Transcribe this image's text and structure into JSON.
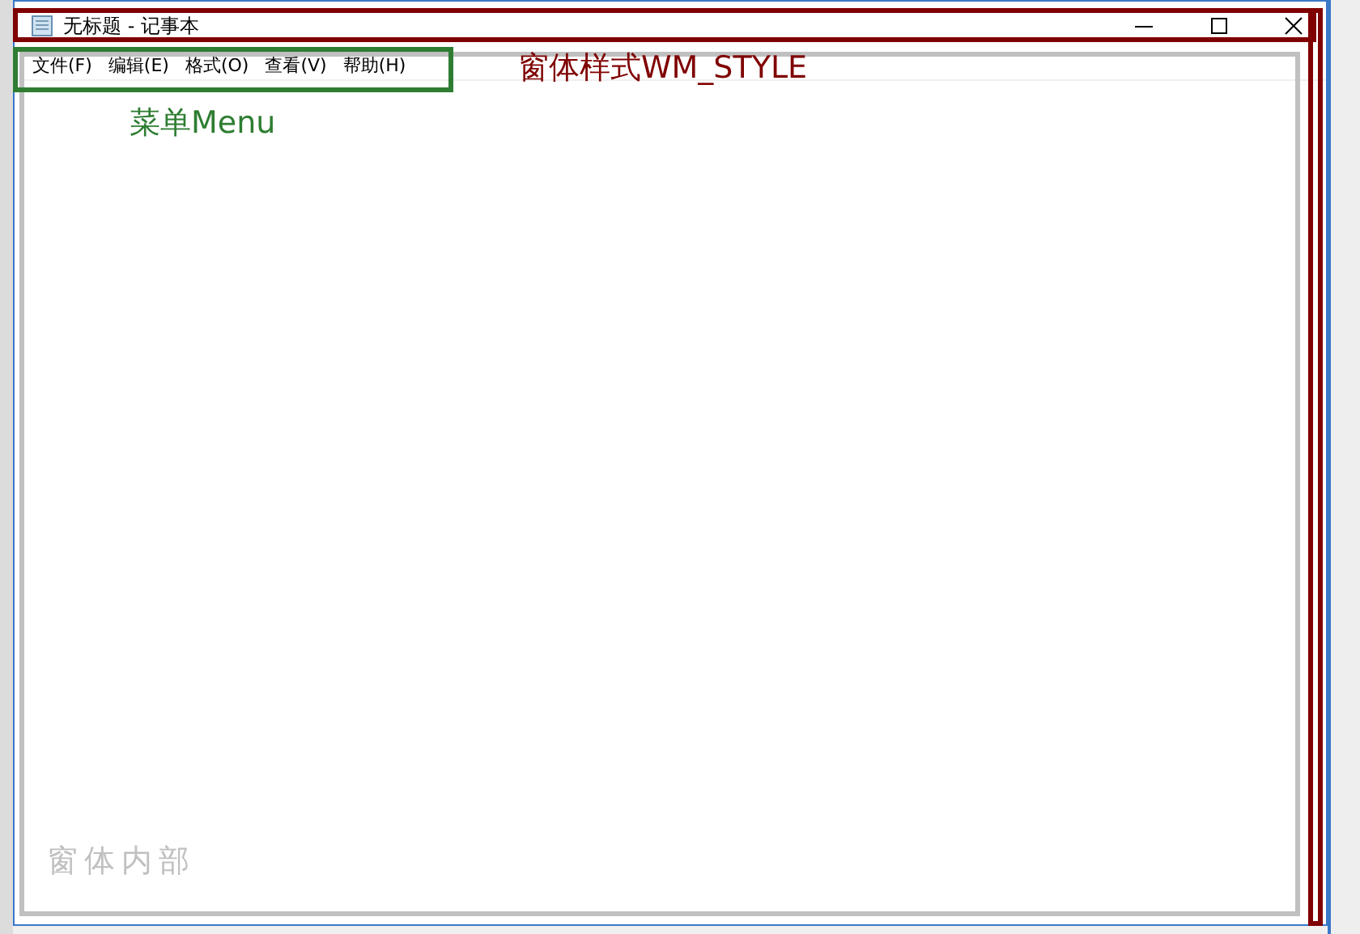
{
  "window": {
    "title": "无标题 - 记事本"
  },
  "menu": [
    {
      "label": "文件(F)"
    },
    {
      "label": "编辑(E)"
    },
    {
      "label": "格式(O)"
    },
    {
      "label": "查看(V)"
    },
    {
      "label": "帮助(H)"
    }
  ],
  "annotations": [
    {
      "kind": "style",
      "text": "窗体样式WM_STYLE",
      "color": "#7f0000"
    },
    {
      "kind": "menu",
      "text": "菜单Menu",
      "color": "#2e7d32"
    },
    {
      "kind": "client",
      "text": "窗体内部",
      "color": "#c0c0c0"
    }
  ]
}
